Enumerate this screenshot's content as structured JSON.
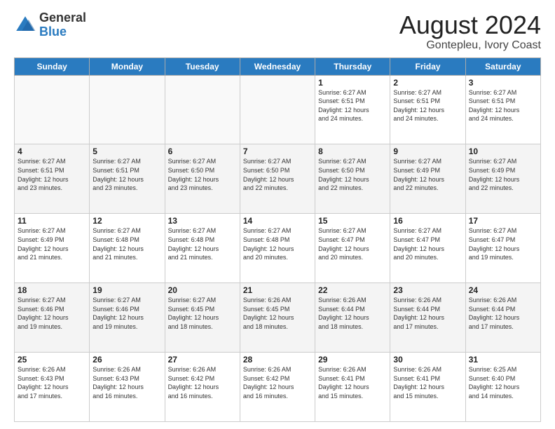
{
  "header": {
    "logo_line1": "General",
    "logo_line2": "Blue",
    "title": "August 2024",
    "location": "Gontepleu, Ivory Coast"
  },
  "days_of_week": [
    "Sunday",
    "Monday",
    "Tuesday",
    "Wednesday",
    "Thursday",
    "Friday",
    "Saturday"
  ],
  "weeks": [
    [
      {
        "day": "",
        "info": ""
      },
      {
        "day": "",
        "info": ""
      },
      {
        "day": "",
        "info": ""
      },
      {
        "day": "",
        "info": ""
      },
      {
        "day": "1",
        "info": "Sunrise: 6:27 AM\nSunset: 6:51 PM\nDaylight: 12 hours\nand 24 minutes."
      },
      {
        "day": "2",
        "info": "Sunrise: 6:27 AM\nSunset: 6:51 PM\nDaylight: 12 hours\nand 24 minutes."
      },
      {
        "day": "3",
        "info": "Sunrise: 6:27 AM\nSunset: 6:51 PM\nDaylight: 12 hours\nand 24 minutes."
      }
    ],
    [
      {
        "day": "4",
        "info": "Sunrise: 6:27 AM\nSunset: 6:51 PM\nDaylight: 12 hours\nand 23 minutes."
      },
      {
        "day": "5",
        "info": "Sunrise: 6:27 AM\nSunset: 6:51 PM\nDaylight: 12 hours\nand 23 minutes."
      },
      {
        "day": "6",
        "info": "Sunrise: 6:27 AM\nSunset: 6:50 PM\nDaylight: 12 hours\nand 23 minutes."
      },
      {
        "day": "7",
        "info": "Sunrise: 6:27 AM\nSunset: 6:50 PM\nDaylight: 12 hours\nand 22 minutes."
      },
      {
        "day": "8",
        "info": "Sunrise: 6:27 AM\nSunset: 6:50 PM\nDaylight: 12 hours\nand 22 minutes."
      },
      {
        "day": "9",
        "info": "Sunrise: 6:27 AM\nSunset: 6:49 PM\nDaylight: 12 hours\nand 22 minutes."
      },
      {
        "day": "10",
        "info": "Sunrise: 6:27 AM\nSunset: 6:49 PM\nDaylight: 12 hours\nand 22 minutes."
      }
    ],
    [
      {
        "day": "11",
        "info": "Sunrise: 6:27 AM\nSunset: 6:49 PM\nDaylight: 12 hours\nand 21 minutes."
      },
      {
        "day": "12",
        "info": "Sunrise: 6:27 AM\nSunset: 6:48 PM\nDaylight: 12 hours\nand 21 minutes."
      },
      {
        "day": "13",
        "info": "Sunrise: 6:27 AM\nSunset: 6:48 PM\nDaylight: 12 hours\nand 21 minutes."
      },
      {
        "day": "14",
        "info": "Sunrise: 6:27 AM\nSunset: 6:48 PM\nDaylight: 12 hours\nand 20 minutes."
      },
      {
        "day": "15",
        "info": "Sunrise: 6:27 AM\nSunset: 6:47 PM\nDaylight: 12 hours\nand 20 minutes."
      },
      {
        "day": "16",
        "info": "Sunrise: 6:27 AM\nSunset: 6:47 PM\nDaylight: 12 hours\nand 20 minutes."
      },
      {
        "day": "17",
        "info": "Sunrise: 6:27 AM\nSunset: 6:47 PM\nDaylight: 12 hours\nand 19 minutes."
      }
    ],
    [
      {
        "day": "18",
        "info": "Sunrise: 6:27 AM\nSunset: 6:46 PM\nDaylight: 12 hours\nand 19 minutes."
      },
      {
        "day": "19",
        "info": "Sunrise: 6:27 AM\nSunset: 6:46 PM\nDaylight: 12 hours\nand 19 minutes."
      },
      {
        "day": "20",
        "info": "Sunrise: 6:27 AM\nSunset: 6:45 PM\nDaylight: 12 hours\nand 18 minutes."
      },
      {
        "day": "21",
        "info": "Sunrise: 6:26 AM\nSunset: 6:45 PM\nDaylight: 12 hours\nand 18 minutes."
      },
      {
        "day": "22",
        "info": "Sunrise: 6:26 AM\nSunset: 6:44 PM\nDaylight: 12 hours\nand 18 minutes."
      },
      {
        "day": "23",
        "info": "Sunrise: 6:26 AM\nSunset: 6:44 PM\nDaylight: 12 hours\nand 17 minutes."
      },
      {
        "day": "24",
        "info": "Sunrise: 6:26 AM\nSunset: 6:44 PM\nDaylight: 12 hours\nand 17 minutes."
      }
    ],
    [
      {
        "day": "25",
        "info": "Sunrise: 6:26 AM\nSunset: 6:43 PM\nDaylight: 12 hours\nand 17 minutes."
      },
      {
        "day": "26",
        "info": "Sunrise: 6:26 AM\nSunset: 6:43 PM\nDaylight: 12 hours\nand 16 minutes."
      },
      {
        "day": "27",
        "info": "Sunrise: 6:26 AM\nSunset: 6:42 PM\nDaylight: 12 hours\nand 16 minutes."
      },
      {
        "day": "28",
        "info": "Sunrise: 6:26 AM\nSunset: 6:42 PM\nDaylight: 12 hours\nand 16 minutes."
      },
      {
        "day": "29",
        "info": "Sunrise: 6:26 AM\nSunset: 6:41 PM\nDaylight: 12 hours\nand 15 minutes."
      },
      {
        "day": "30",
        "info": "Sunrise: 6:26 AM\nSunset: 6:41 PM\nDaylight: 12 hours\nand 15 minutes."
      },
      {
        "day": "31",
        "info": "Sunrise: 6:25 AM\nSunset: 6:40 PM\nDaylight: 12 hours\nand 14 minutes."
      }
    ]
  ],
  "colors": {
    "header_bg": "#2a7bc0",
    "header_text": "#ffffff",
    "accent": "#2a7bc0"
  }
}
